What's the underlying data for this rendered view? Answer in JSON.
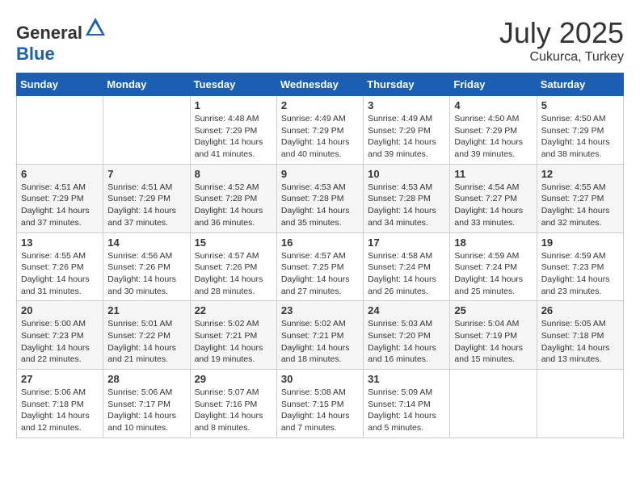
{
  "header": {
    "logo_general": "General",
    "logo_blue": "Blue",
    "month": "July 2025",
    "location": "Cukurca, Turkey"
  },
  "weekdays": [
    "Sunday",
    "Monday",
    "Tuesday",
    "Wednesday",
    "Thursday",
    "Friday",
    "Saturday"
  ],
  "weeks": [
    [
      {
        "day": "",
        "sunrise": "",
        "sunset": "",
        "daylight": ""
      },
      {
        "day": "",
        "sunrise": "",
        "sunset": "",
        "daylight": ""
      },
      {
        "day": "1",
        "sunrise": "Sunrise: 4:48 AM",
        "sunset": "Sunset: 7:29 PM",
        "daylight": "Daylight: 14 hours and 41 minutes."
      },
      {
        "day": "2",
        "sunrise": "Sunrise: 4:49 AM",
        "sunset": "Sunset: 7:29 PM",
        "daylight": "Daylight: 14 hours and 40 minutes."
      },
      {
        "day": "3",
        "sunrise": "Sunrise: 4:49 AM",
        "sunset": "Sunset: 7:29 PM",
        "daylight": "Daylight: 14 hours and 39 minutes."
      },
      {
        "day": "4",
        "sunrise": "Sunrise: 4:50 AM",
        "sunset": "Sunset: 7:29 PM",
        "daylight": "Daylight: 14 hours and 39 minutes."
      },
      {
        "day": "5",
        "sunrise": "Sunrise: 4:50 AM",
        "sunset": "Sunset: 7:29 PM",
        "daylight": "Daylight: 14 hours and 38 minutes."
      }
    ],
    [
      {
        "day": "6",
        "sunrise": "Sunrise: 4:51 AM",
        "sunset": "Sunset: 7:29 PM",
        "daylight": "Daylight: 14 hours and 37 minutes."
      },
      {
        "day": "7",
        "sunrise": "Sunrise: 4:51 AM",
        "sunset": "Sunset: 7:29 PM",
        "daylight": "Daylight: 14 hours and 37 minutes."
      },
      {
        "day": "8",
        "sunrise": "Sunrise: 4:52 AM",
        "sunset": "Sunset: 7:28 PM",
        "daylight": "Daylight: 14 hours and 36 minutes."
      },
      {
        "day": "9",
        "sunrise": "Sunrise: 4:53 AM",
        "sunset": "Sunset: 7:28 PM",
        "daylight": "Daylight: 14 hours and 35 minutes."
      },
      {
        "day": "10",
        "sunrise": "Sunrise: 4:53 AM",
        "sunset": "Sunset: 7:28 PM",
        "daylight": "Daylight: 14 hours and 34 minutes."
      },
      {
        "day": "11",
        "sunrise": "Sunrise: 4:54 AM",
        "sunset": "Sunset: 7:27 PM",
        "daylight": "Daylight: 14 hours and 33 minutes."
      },
      {
        "day": "12",
        "sunrise": "Sunrise: 4:55 AM",
        "sunset": "Sunset: 7:27 PM",
        "daylight": "Daylight: 14 hours and 32 minutes."
      }
    ],
    [
      {
        "day": "13",
        "sunrise": "Sunrise: 4:55 AM",
        "sunset": "Sunset: 7:26 PM",
        "daylight": "Daylight: 14 hours and 31 minutes."
      },
      {
        "day": "14",
        "sunrise": "Sunrise: 4:56 AM",
        "sunset": "Sunset: 7:26 PM",
        "daylight": "Daylight: 14 hours and 30 minutes."
      },
      {
        "day": "15",
        "sunrise": "Sunrise: 4:57 AM",
        "sunset": "Sunset: 7:26 PM",
        "daylight": "Daylight: 14 hours and 28 minutes."
      },
      {
        "day": "16",
        "sunrise": "Sunrise: 4:57 AM",
        "sunset": "Sunset: 7:25 PM",
        "daylight": "Daylight: 14 hours and 27 minutes."
      },
      {
        "day": "17",
        "sunrise": "Sunrise: 4:58 AM",
        "sunset": "Sunset: 7:24 PM",
        "daylight": "Daylight: 14 hours and 26 minutes."
      },
      {
        "day": "18",
        "sunrise": "Sunrise: 4:59 AM",
        "sunset": "Sunset: 7:24 PM",
        "daylight": "Daylight: 14 hours and 25 minutes."
      },
      {
        "day": "19",
        "sunrise": "Sunrise: 4:59 AM",
        "sunset": "Sunset: 7:23 PM",
        "daylight": "Daylight: 14 hours and 23 minutes."
      }
    ],
    [
      {
        "day": "20",
        "sunrise": "Sunrise: 5:00 AM",
        "sunset": "Sunset: 7:23 PM",
        "daylight": "Daylight: 14 hours and 22 minutes."
      },
      {
        "day": "21",
        "sunrise": "Sunrise: 5:01 AM",
        "sunset": "Sunset: 7:22 PM",
        "daylight": "Daylight: 14 hours and 21 minutes."
      },
      {
        "day": "22",
        "sunrise": "Sunrise: 5:02 AM",
        "sunset": "Sunset: 7:21 PM",
        "daylight": "Daylight: 14 hours and 19 minutes."
      },
      {
        "day": "23",
        "sunrise": "Sunrise: 5:02 AM",
        "sunset": "Sunset: 7:21 PM",
        "daylight": "Daylight: 14 hours and 18 minutes."
      },
      {
        "day": "24",
        "sunrise": "Sunrise: 5:03 AM",
        "sunset": "Sunset: 7:20 PM",
        "daylight": "Daylight: 14 hours and 16 minutes."
      },
      {
        "day": "25",
        "sunrise": "Sunrise: 5:04 AM",
        "sunset": "Sunset: 7:19 PM",
        "daylight": "Daylight: 14 hours and 15 minutes."
      },
      {
        "day": "26",
        "sunrise": "Sunrise: 5:05 AM",
        "sunset": "Sunset: 7:18 PM",
        "daylight": "Daylight: 14 hours and 13 minutes."
      }
    ],
    [
      {
        "day": "27",
        "sunrise": "Sunrise: 5:06 AM",
        "sunset": "Sunset: 7:18 PM",
        "daylight": "Daylight: 14 hours and 12 minutes."
      },
      {
        "day": "28",
        "sunrise": "Sunrise: 5:06 AM",
        "sunset": "Sunset: 7:17 PM",
        "daylight": "Daylight: 14 hours and 10 minutes."
      },
      {
        "day": "29",
        "sunrise": "Sunrise: 5:07 AM",
        "sunset": "Sunset: 7:16 PM",
        "daylight": "Daylight: 14 hours and 8 minutes."
      },
      {
        "day": "30",
        "sunrise": "Sunrise: 5:08 AM",
        "sunset": "Sunset: 7:15 PM",
        "daylight": "Daylight: 14 hours and 7 minutes."
      },
      {
        "day": "31",
        "sunrise": "Sunrise: 5:09 AM",
        "sunset": "Sunset: 7:14 PM",
        "daylight": "Daylight: 14 hours and 5 minutes."
      },
      {
        "day": "",
        "sunrise": "",
        "sunset": "",
        "daylight": ""
      },
      {
        "day": "",
        "sunrise": "",
        "sunset": "",
        "daylight": ""
      }
    ]
  ]
}
